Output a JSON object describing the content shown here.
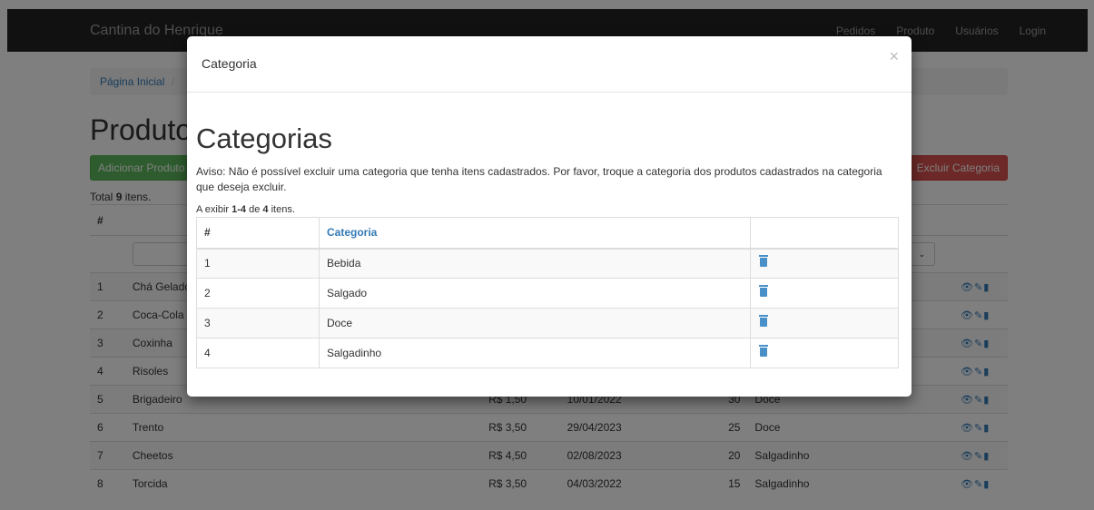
{
  "navbar": {
    "brand": "Cantina do Henrique",
    "links": [
      "Pedidos",
      "Produto",
      "Usuários",
      "Login"
    ]
  },
  "breadcrumb": {
    "home": "Página Inicial",
    "separator": "/"
  },
  "page": {
    "title": "Produtos",
    "add_button": "Adicionar Produto",
    "delete_category_button": "Excluir Categoria",
    "summary_prefix": "Total ",
    "summary_count": "9",
    "summary_suffix": " itens."
  },
  "products_table": {
    "header_hash": "#",
    "rows": [
      {
        "id": "1",
        "name": "Chá Gelado",
        "price": "",
        "date": "",
        "qty": "",
        "category": ""
      },
      {
        "id": "2",
        "name": "Coca-Cola",
        "price": "",
        "date": "",
        "qty": "",
        "category": ""
      },
      {
        "id": "3",
        "name": "Coxinha",
        "price": "",
        "date": "",
        "qty": "",
        "category": ""
      },
      {
        "id": "4",
        "name": "Risoles",
        "price": "",
        "date": "",
        "qty": "",
        "category": ""
      },
      {
        "id": "5",
        "name": "Brigadeiro",
        "price": "R$ 1,50",
        "date": "10/01/2022",
        "qty": "30",
        "category": "Doce"
      },
      {
        "id": "6",
        "name": "Trento",
        "price": "R$ 3,50",
        "date": "29/04/2023",
        "qty": "25",
        "category": "Doce"
      },
      {
        "id": "7",
        "name": "Cheetos",
        "price": "R$ 4,50",
        "date": "02/08/2023",
        "qty": "20",
        "category": "Salgadinho"
      },
      {
        "id": "8",
        "name": "Torcida",
        "price": "R$ 3,50",
        "date": "04/03/2022",
        "qty": "15",
        "category": "Salgadinho"
      }
    ]
  },
  "modal": {
    "title": "Categoria",
    "close": "×",
    "heading": "Categorias",
    "warning": "Aviso: Não é possível excluir uma categoria que tenha itens cadastrados. Por favor, troque a categoria dos produtos cadastrados na categoria que deseja excluir.",
    "count_prefix": "A exibir ",
    "count_range": "1-4",
    "count_mid": " de ",
    "count_total": "4",
    "count_suffix": " itens.",
    "table": {
      "col_hash": "#",
      "col_category": "Categoria",
      "rows": [
        {
          "id": "1",
          "name": "Bebida"
        },
        {
          "id": "2",
          "name": "Salgado"
        },
        {
          "id": "3",
          "name": "Doce"
        },
        {
          "id": "4",
          "name": "Salgadinho"
        }
      ]
    }
  }
}
